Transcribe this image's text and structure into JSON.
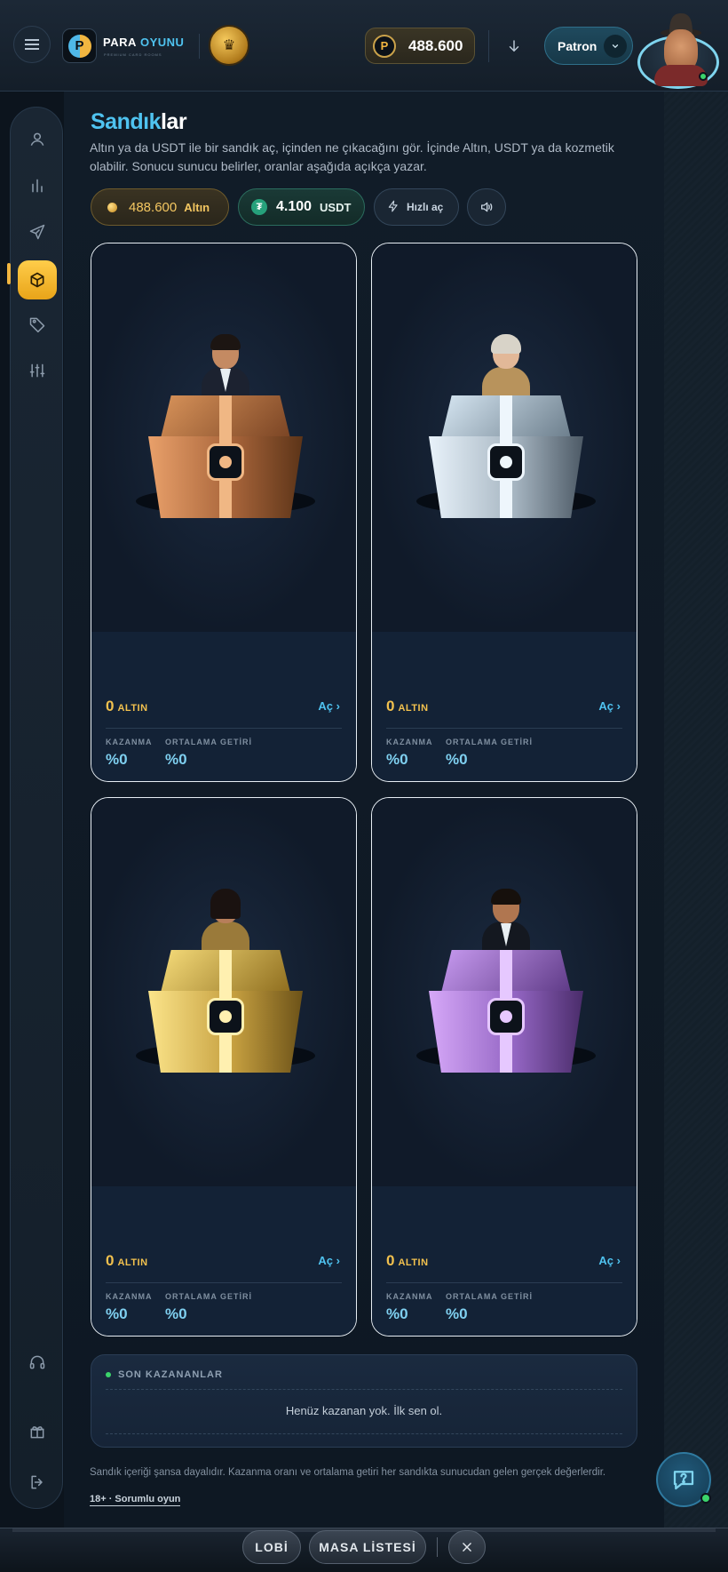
{
  "header": {
    "brand_word1": "PARA",
    "brand_word2": "OYUNU",
    "brand_tagline": "PREMIUM CARD ROOMS",
    "logo_letter": "P",
    "balance_coin_letter": "P",
    "balance": "488.600",
    "user_name": "Patron"
  },
  "page": {
    "title_part1": "Sandık",
    "title_part2": "lar",
    "description": "Altın ya da USDT ile bir sandık aç, içinden ne çıkacağını gör. İçinde Altın, USDT ya da kozmetik olabilir. Sonucu sunucu belirler, oranlar aşağıda açıkça yazar."
  },
  "wallet_chips": {
    "gold_value": "488.600",
    "gold_unit": "Altın",
    "usdt_symbol": "₮",
    "usdt_value": "4.100",
    "usdt_unit": "USDT",
    "fast_open_label": "Hızlı aç"
  },
  "chests": [
    {
      "id": "bronze",
      "price": "0",
      "unit": "ALTIN",
      "open_label": "Aç",
      "win_label": "KAZANMA",
      "win_value": "%0",
      "avg_label": "ORTALAMA GETİRİ",
      "avg_value": "%0"
    },
    {
      "id": "silver",
      "price": "0",
      "unit": "ALTIN",
      "open_label": "Aç",
      "win_label": "KAZANMA",
      "win_value": "%0",
      "avg_label": "ORTALAMA GETİRİ",
      "avg_value": "%0"
    },
    {
      "id": "gold",
      "price": "0",
      "unit": "ALTIN",
      "open_label": "Aç",
      "win_label": "KAZANMA",
      "win_value": "%0",
      "avg_label": "ORTALAMA GETİRİ",
      "avg_value": "%0"
    },
    {
      "id": "purple",
      "price": "0",
      "unit": "ALTIN",
      "open_label": "Aç",
      "win_label": "KAZANMA",
      "win_value": "%0",
      "avg_label": "ORTALAMA GETİRİ",
      "avg_value": "%0"
    }
  ],
  "winners": {
    "title": "SON KAZANANLAR",
    "empty_text": "Henüz kazanan yok. İlk sen ol."
  },
  "footer": {
    "note": "Sandık içeriği şansa dayalıdır. Kazanma oranı ve ortalama getiri her sandıkta sunucudan gelen gerçek değerlerdir.",
    "responsible": "18+ · Sorumlu oyun"
  },
  "bottom_nav": {
    "lobby": "LOBİ",
    "tables": "MASA LİSTESİ"
  },
  "colors": {
    "accent_blue": "#4fc3f0",
    "accent_gold": "#f2b640",
    "price_gold": "#f2c14e",
    "online_green": "#3bd46b"
  },
  "icons": {
    "sidebar": [
      "profile-icon",
      "stats-icon",
      "send-icon",
      "chest-icon",
      "tag-icon",
      "sliders-icon",
      "headset-icon",
      "gift-icon",
      "logout-icon"
    ]
  }
}
